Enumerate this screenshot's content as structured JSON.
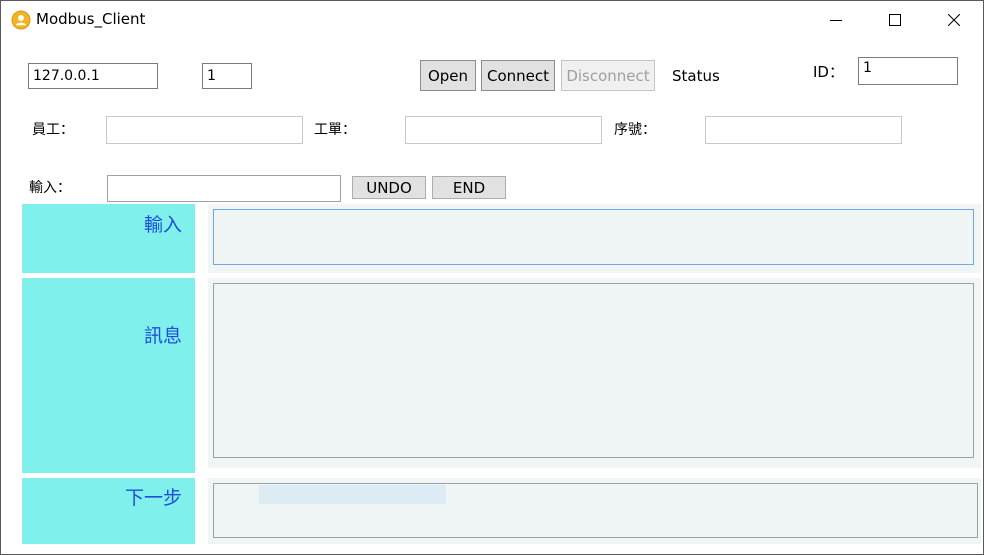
{
  "window": {
    "title": "Modbus_Client",
    "icon": "user-circle-icon",
    "controls": [
      "minimize-icon",
      "maximize-icon",
      "close-icon"
    ]
  },
  "connection": {
    "ip": "127.0.0.1",
    "port_value": "1",
    "open_label": "Open",
    "connect_label": "Connect",
    "disconnect_label": "Disconnect",
    "status_label": "Status",
    "id_label": "ID：",
    "id_value": "1"
  },
  "fields": {
    "employee_label": "員工：",
    "employee_value": "",
    "workorder_label": "工單：",
    "workorder_value": "",
    "serial_label": "序號：",
    "serial_value": ""
  },
  "input_row": {
    "label": "輸入：",
    "value": "",
    "undo_label": "UNDO",
    "end_label": "END"
  },
  "panels": [
    {
      "label": "輸入",
      "value": ""
    },
    {
      "label": "訊息",
      "value": ""
    },
    {
      "label": "下一步",
      "value": ""
    }
  ],
  "colors": {
    "label_cell": "#7ff0ec",
    "label_text": "#1f4fd6",
    "panel_bg": "#f2f5f5",
    "textbox_bg": "#eef5f4",
    "focus_border": "#6ea8e4",
    "disabled_text": "#a0a0a0"
  }
}
